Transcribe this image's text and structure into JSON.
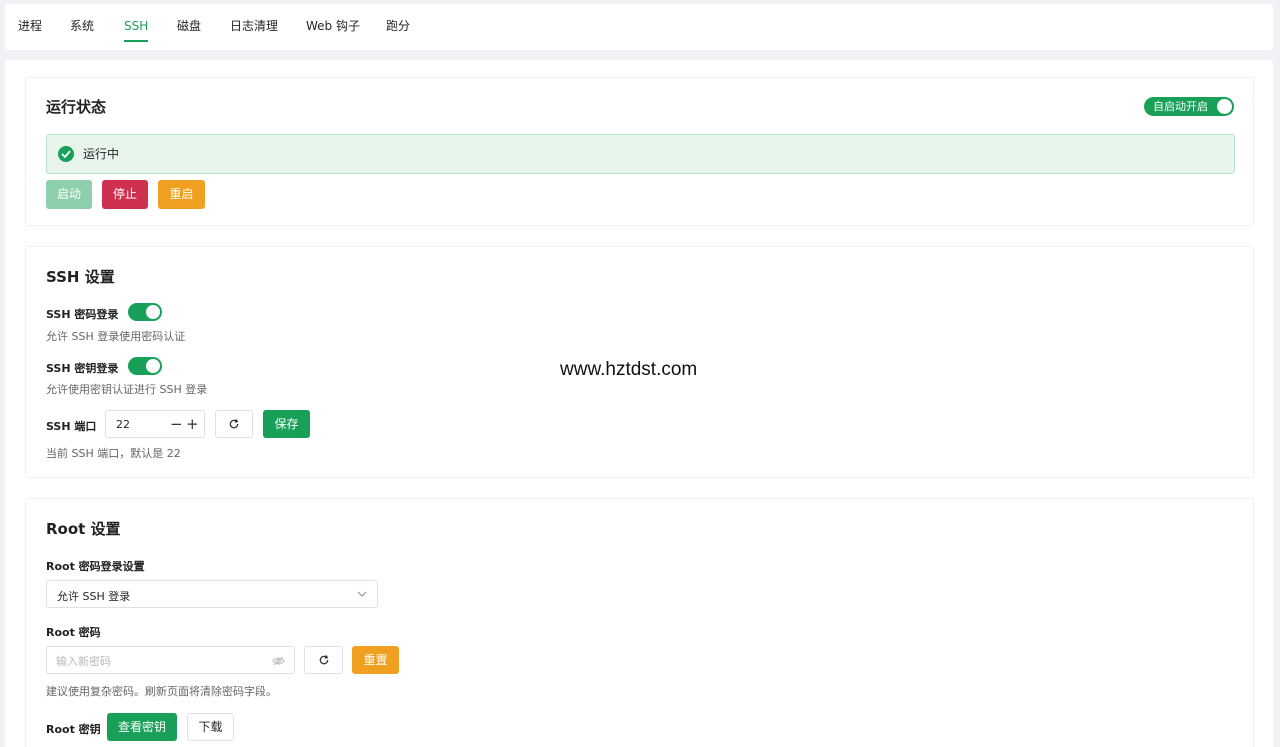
{
  "tabs": [
    {
      "label": "进程",
      "active": false
    },
    {
      "label": "系统",
      "active": false
    },
    {
      "label": "SSH",
      "active": true
    },
    {
      "label": "磁盘",
      "active": false
    },
    {
      "label": "日志清理",
      "active": false
    },
    {
      "label": "Web 钩子",
      "active": false
    },
    {
      "label": "跑分",
      "active": false
    }
  ],
  "status_card": {
    "title": "运行状态",
    "autostart_label": "自启动开启",
    "autostart_on": true,
    "status_text": "运行中",
    "buttons": {
      "start": "启动",
      "stop": "停止",
      "restart": "重启"
    }
  },
  "ssh_card": {
    "title": "SSH 设置",
    "password_login": {
      "label": "SSH 密码登录",
      "enabled": true,
      "hint": "允许 SSH 登录使用密码认证"
    },
    "key_login": {
      "label": "SSH 密钥登录",
      "enabled": true,
      "hint": "允许使用密钥认证进行 SSH 登录"
    },
    "port": {
      "label": "SSH 端口",
      "value": "22",
      "minus": "−",
      "plus": "+",
      "save_label": "保存",
      "hint": "当前 SSH 端口，默认是 22"
    }
  },
  "root_card": {
    "title": "Root 设置",
    "password_login_setting": {
      "label": "Root 密码登录设置",
      "selected": "允许 SSH 登录"
    },
    "password": {
      "label": "Root 密码",
      "placeholder": "输入新密码",
      "reset_label": "重置",
      "hint": "建议使用复杂密码。刷新页面将清除密码字段。"
    },
    "key": {
      "label": "Root 密钥",
      "view_label": "查看密钥",
      "download_label": "下载"
    }
  },
  "watermark": "www.hztdst.com",
  "colors": {
    "primary": "#18a058",
    "danger": "#d03050",
    "warning": "#f0a020"
  }
}
